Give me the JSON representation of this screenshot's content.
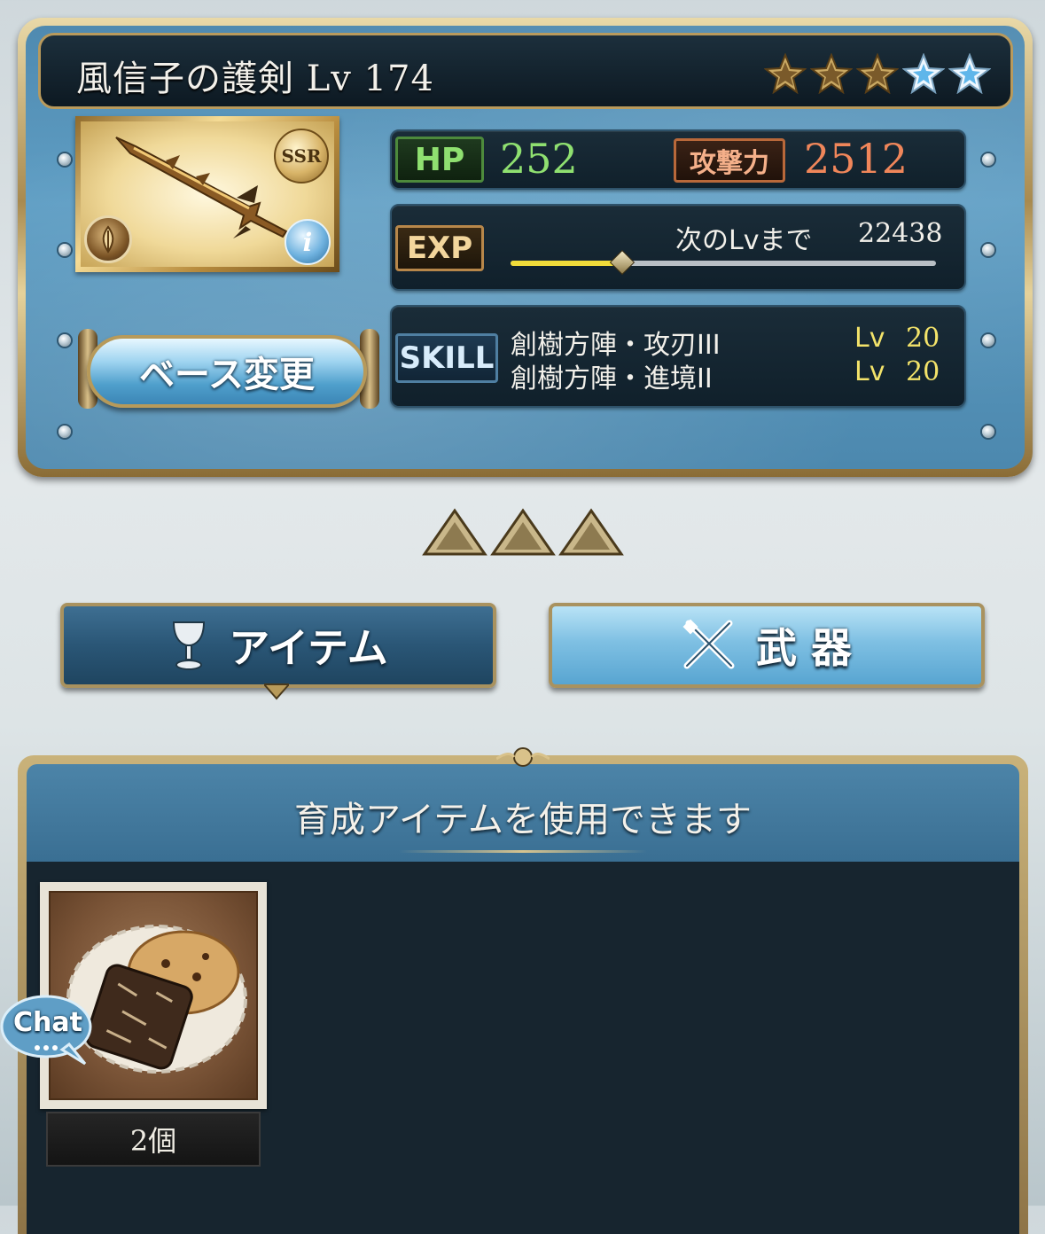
{
  "weapon": {
    "name": "風信子の護剣",
    "level_label": "Lv",
    "level": "174",
    "rarity_badge": "SSR",
    "info_badge": "i",
    "stars": {
      "filled": 3,
      "uncap": 2,
      "total": 5
    }
  },
  "stats": {
    "hp_label": "HP",
    "hp_value": "252",
    "atk_label": "攻撃力",
    "atk_value": "2512"
  },
  "exp": {
    "label": "EXP",
    "next_label": "次のLvまで",
    "next_value": "22438",
    "progress": 0.26
  },
  "skills": {
    "label": "SKILL",
    "items": [
      {
        "name": "創樹方陣・攻刃III",
        "level_label": "Lv",
        "level": "20"
      },
      {
        "name": "創樹方陣・進境II",
        "level_label": "Lv",
        "level": "20"
      }
    ]
  },
  "base_change_label": "ベース変更",
  "tabs": [
    {
      "label": "アイテム",
      "icon": "goblet-icon",
      "active": false
    },
    {
      "label": "武 器",
      "icon": "crossed-swords-icon",
      "active": true
    }
  ],
  "panel": {
    "title": "育成アイテムを使用できます",
    "items": [
      {
        "icon": "cookie-icon",
        "count": "2個"
      }
    ]
  },
  "chat_label": "Chat",
  "colors": {
    "hp": "#8fe070",
    "atk": "#f0865a",
    "skill_level": "#f3e36a",
    "exp_bar": "#f0dc3a"
  }
}
